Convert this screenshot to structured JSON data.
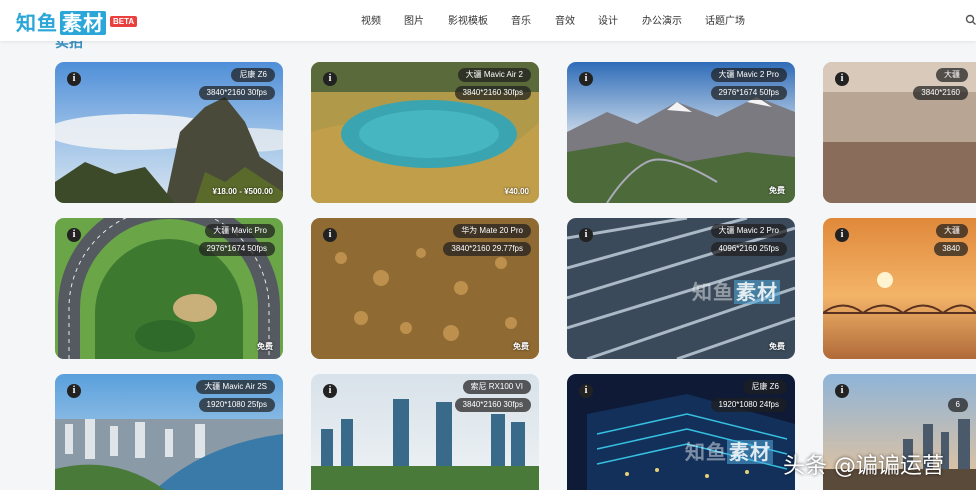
{
  "logo": {
    "part1": "知鱼",
    "part2": "素材",
    "beta": "BETA"
  },
  "nav": [
    "视频",
    "图片",
    "影视模板",
    "音乐",
    "音效",
    "设计",
    "办公演示",
    "话题广场"
  ],
  "section_title": "实拍",
  "cards": [
    {
      "device": "尼康 Z6",
      "resolution": "3840*2160 30fps",
      "price": "¥18.00 - ¥500.00"
    },
    {
      "device": "大疆 Mavic Air 2",
      "resolution": "3840*2160 30fps",
      "price": "¥40.00"
    },
    {
      "device": "大疆 Mavic 2 Pro",
      "resolution": "2976*1674 50fps",
      "price": "免费"
    },
    {
      "device": "大疆",
      "resolution": "3840*2160",
      "price": ""
    },
    {
      "device": "大疆 Mavic Pro",
      "resolution": "2976*1674 50fps",
      "price": "免费"
    },
    {
      "device": "华为 Mate 20 Pro",
      "resolution": "3840*2160 29.77fps",
      "price": "免费"
    },
    {
      "device": "大疆 Mavic 2 Pro",
      "resolution": "4096*2160 25fps",
      "price": "免费"
    },
    {
      "device": "大疆",
      "resolution": "3840",
      "price": ""
    },
    {
      "device": "大疆 Mavic Air 2S",
      "resolution": "1920*1080 25fps",
      "price": ""
    },
    {
      "device": "索尼 RX100 VI",
      "resolution": "3840*2160 30fps",
      "price": ""
    },
    {
      "device": "尼康 Z6",
      "resolution": "1920*1080 24fps",
      "price": ""
    },
    {
      "device": "",
      "resolution": "6",
      "price": ""
    }
  ],
  "watermark": {
    "part1": "知鱼",
    "part2": "素材"
  },
  "credit": "头条 @谝谝运营",
  "colors": {
    "brand": "#2aa6d8",
    "beta": "#ea3f3f",
    "badge_bg": "#1e1e1e"
  }
}
